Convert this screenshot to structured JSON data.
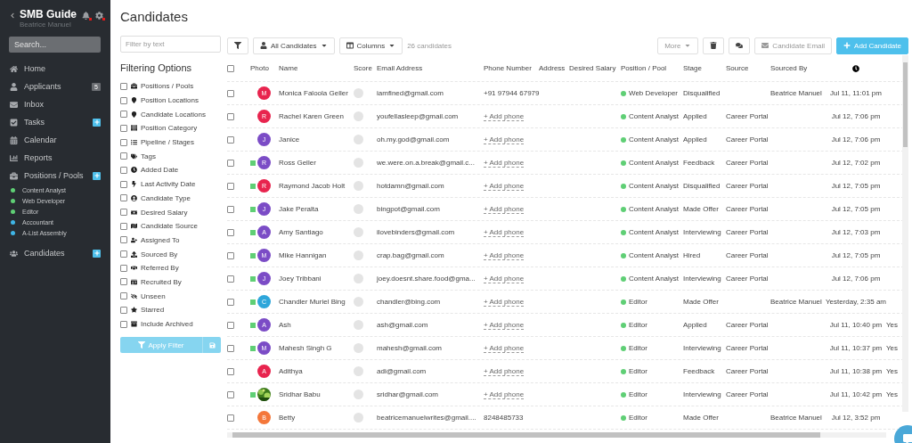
{
  "sidebar": {
    "title": "SMB Guide",
    "user": "Beatrice Manuel",
    "search": {
      "placeholder": "Search..."
    },
    "items": [
      {
        "label": "Home",
        "add": false
      },
      {
        "label": "Applicants",
        "badge": "5",
        "add": false
      },
      {
        "label": "Inbox",
        "add": false
      },
      {
        "label": "Tasks",
        "add": true
      },
      {
        "label": "Calendar",
        "add": false
      },
      {
        "label": "Reports",
        "add": false
      },
      {
        "label": "Positions / Pools",
        "add": true,
        "children": [
          {
            "label": "Content Analyst",
            "color": "#5fcf75"
          },
          {
            "label": "Web Developer",
            "color": "#5fcf75"
          },
          {
            "label": "Editor",
            "color": "#5fcf75"
          },
          {
            "label": "Accountant",
            "color": "#3fb5e6"
          },
          {
            "label": "A-List Assembly",
            "color": "#3fb5e6"
          }
        ]
      },
      {
        "label": "Candidates",
        "add": true
      }
    ]
  },
  "page_title": "Candidates",
  "filters": {
    "search": {
      "placeholder": "Filter by text"
    },
    "heading": "Filtering Options",
    "options": [
      {
        "label": "Positions / Pools",
        "checked": false
      },
      {
        "label": "Position Locations",
        "checked": false
      },
      {
        "label": "Candidate Locations",
        "checked": false
      },
      {
        "label": "Position Category",
        "checked": false
      },
      {
        "label": "Pipeline / Stages",
        "checked": false
      },
      {
        "label": "Tags",
        "checked": false
      },
      {
        "label": "Added Date",
        "checked": false
      },
      {
        "label": "Last Activity Date",
        "checked": false
      },
      {
        "label": "Candidate Type",
        "checked": false
      },
      {
        "label": "Desired Salary",
        "checked": false
      },
      {
        "label": "Candidate Source",
        "checked": false
      },
      {
        "label": "Assigned To",
        "checked": false
      },
      {
        "label": "Sourced By",
        "checked": false
      },
      {
        "label": "Referred By",
        "checked": false
      },
      {
        "label": "Recruited By",
        "checked": false
      },
      {
        "label": "Unseen",
        "checked": false
      },
      {
        "label": "Starred",
        "checked": false
      },
      {
        "label": "Include Archived",
        "checked": false
      }
    ],
    "apply_button": "Apply Filter"
  },
  "toolbar": {
    "view": "All Candidates",
    "columns": "Columns",
    "count": "26 candidates",
    "more": "More",
    "email": "Candidate Email",
    "add": "Add Candidate"
  },
  "table": {
    "columns": [
      "Photo",
      "Name",
      "Score",
      "Email Address",
      "Phone Number",
      "Address",
      "Desired Salary",
      "Position / Pool",
      "Stage",
      "Source",
      "Sourced By"
    ],
    "header_checked": false,
    "rows": [
      {
        "checked": false,
        "flagged": false,
        "avatar": {
          "kind": "initial",
          "initial": "M",
          "color": "#e8244e"
        },
        "name": "Monica Faloola Geller",
        "email": "iamfined@gmail.com",
        "phone": {
          "kind": "value",
          "text": "+91 97944 67979"
        },
        "position": {
          "name": "Web Developer",
          "color": "#5fcf75"
        },
        "stage": "Disqualified",
        "sourced_by": "Beatrice Manuel",
        "time": "Jul 11, 11:01 pm"
      },
      {
        "checked": false,
        "flagged": false,
        "avatar": {
          "kind": "initial",
          "initial": "R",
          "color": "#e8244e"
        },
        "name": "Rachel Karen Green",
        "email": "youfellasleep@gmail.com",
        "phone": {
          "kind": "link",
          "text": "+ Add phone"
        },
        "position": {
          "name": "Content Analyst",
          "color": "#5fcf75"
        },
        "stage": "Applied",
        "source": "Career Portal",
        "time": "Jul 12, 7:06 pm"
      },
      {
        "checked": false,
        "flagged": false,
        "avatar": {
          "kind": "initial",
          "initial": "J",
          "color": "#7b4cc6"
        },
        "name": "Janice",
        "email": "oh.my.god@gmail.com",
        "phone": {
          "kind": "link",
          "text": "+ Add phone"
        },
        "position": {
          "name": "Content Analyst",
          "color": "#5fcf75"
        },
        "stage": "Applied",
        "source": "Career Portal",
        "time": "Jul 12, 7:06 pm"
      },
      {
        "checked": false,
        "flagged": true,
        "avatar": {
          "kind": "initial",
          "initial": "R",
          "color": "#7b4cc6"
        },
        "name": "Ross Geller",
        "email": "we.were.on.a.break@gmail.c...",
        "phone": {
          "kind": "link",
          "text": "+ Add phone"
        },
        "position": {
          "name": "Content Analyst",
          "color": "#5fcf75"
        },
        "stage": "Feedback",
        "source": "Career Portal",
        "time": "Jul 12, 7:02 pm"
      },
      {
        "checked": false,
        "flagged": true,
        "avatar": {
          "kind": "initial",
          "initial": "R",
          "color": "#e8244e"
        },
        "name": "Raymond Jacob Holt",
        "email": "hotdamn@gmail.com",
        "phone": {
          "kind": "link",
          "text": "+ Add phone"
        },
        "position": {
          "name": "Content Analyst",
          "color": "#5fcf75"
        },
        "stage": "Disqualified",
        "source": "Career Portal",
        "time": "Jul 12, 7:05 pm"
      },
      {
        "checked": false,
        "flagged": true,
        "avatar": {
          "kind": "initial",
          "initial": "J",
          "color": "#7b4cc6"
        },
        "name": "Jake Peralta",
        "email": "bingpot@gmail.com",
        "phone": {
          "kind": "link",
          "text": "+ Add phone"
        },
        "position": {
          "name": "Content Analyst",
          "color": "#5fcf75"
        },
        "stage": "Made Offer",
        "source": "Career Portal",
        "time": "Jul 12, 7:05 pm"
      },
      {
        "checked": false,
        "flagged": true,
        "avatar": {
          "kind": "initial",
          "initial": "A",
          "color": "#7b4cc6"
        },
        "name": "Amy Santiago",
        "email": "ilovebinders@gmail.com",
        "phone": {
          "kind": "link",
          "text": "+ Add phone"
        },
        "position": {
          "name": "Content Analyst",
          "color": "#5fcf75"
        },
        "stage": "Interviewing",
        "source": "Career Portal",
        "time": "Jul 12, 7:03 pm"
      },
      {
        "checked": false,
        "flagged": true,
        "avatar": {
          "kind": "initial",
          "initial": "M",
          "color": "#7b4cc6"
        },
        "name": "Mike Hannigan",
        "email": "crap.bag@gmail.com",
        "phone": {
          "kind": "link",
          "text": "+ Add phone"
        },
        "position": {
          "name": "Content Analyst",
          "color": "#5fcf75"
        },
        "stage": "Hired",
        "source": "Career Portal",
        "time": "Jul 12, 7:05 pm"
      },
      {
        "checked": false,
        "flagged": true,
        "avatar": {
          "kind": "initial",
          "initial": "J",
          "color": "#7b4cc6"
        },
        "name": "Joey Tribbani",
        "email": "joey.doesnt.share.food@gma...",
        "phone": {
          "kind": "link",
          "text": "+ Add phone"
        },
        "position": {
          "name": "Content Analyst",
          "color": "#5fcf75"
        },
        "stage": "Interviewing",
        "source": "Career Portal",
        "time": "Jul 12, 7:06 pm"
      },
      {
        "checked": false,
        "flagged": true,
        "avatar": {
          "kind": "initial",
          "initial": "C",
          "color": "#2ea6da"
        },
        "name": "Chandler Muriel Bing",
        "email": "chandler@bing.com",
        "phone": {
          "kind": "link",
          "text": "+ Add phone"
        },
        "position": {
          "name": "Editor",
          "color": "#5fcf75"
        },
        "stage": "Made Offer",
        "sourced_by": "Beatrice Manuel",
        "time": "Yesterday, 2:35 am"
      },
      {
        "checked": false,
        "flagged": true,
        "avatar": {
          "kind": "initial",
          "initial": "A",
          "color": "#7b4cc6"
        },
        "name": "Ash",
        "email": "ash@gmail.com",
        "phone": {
          "kind": "link",
          "text": "+ Add phone"
        },
        "position": {
          "name": "Editor",
          "color": "#5fcf75"
        },
        "stage": "Applied",
        "source": "Career Portal",
        "time": "Jul 11, 10:40 pm",
        "column_14": "Yes"
      },
      {
        "checked": false,
        "flagged": true,
        "avatar": {
          "kind": "initial",
          "initial": "M",
          "color": "#7b4cc6"
        },
        "name": "Mahesh Singh G",
        "email": "mahesh@gmail.com",
        "phone": {
          "kind": "link",
          "text": "+ Add phone"
        },
        "position": {
          "name": "Editor",
          "color": "#5fcf75"
        },
        "stage": "Interviewing",
        "source": "Career Portal",
        "time": "Jul 11, 10:37 pm",
        "column_14": "Yes"
      },
      {
        "checked": false,
        "flagged": false,
        "avatar": {
          "kind": "initial",
          "initial": "A",
          "color": "#e8244e"
        },
        "name": "Adithya",
        "email": "adi@gmail.com",
        "phone": {
          "kind": "link",
          "text": "+ Add phone"
        },
        "position": {
          "name": "Editor",
          "color": "#5fcf75"
        },
        "stage": "Feedback",
        "source": "Career Portal",
        "time": "Jul 11, 10:38 pm",
        "column_14": "Yes"
      },
      {
        "checked": false,
        "flagged": true,
        "name": "Sridhar Babu",
        "email": "sridhar@gmail.com",
        "phone": {
          "kind": "link",
          "text": "+ Add phone"
        },
        "position": {
          "name": "Editor",
          "color": "#5fcf75"
        },
        "stage": "Interviewing",
        "source": "Career Portal",
        "time": "Jul 11, 10:42 pm",
        "column_14": "Yes"
      },
      {
        "checked": false,
        "flagged": false,
        "avatar": {
          "kind": "initial",
          "initial": "B",
          "color": "#f4773a"
        },
        "name": "Betty",
        "email": "beatricemanuelwrites@gmail....",
        "phone": {
          "kind": "value",
          "text": "8248485733"
        },
        "position": {
          "name": "Editor",
          "color": "#5fcf75"
        },
        "stage": "Made Offer",
        "sourced_by": "Beatrice Manuel",
        "time": "Jul 12, 3:52 pm"
      }
    ]
  }
}
